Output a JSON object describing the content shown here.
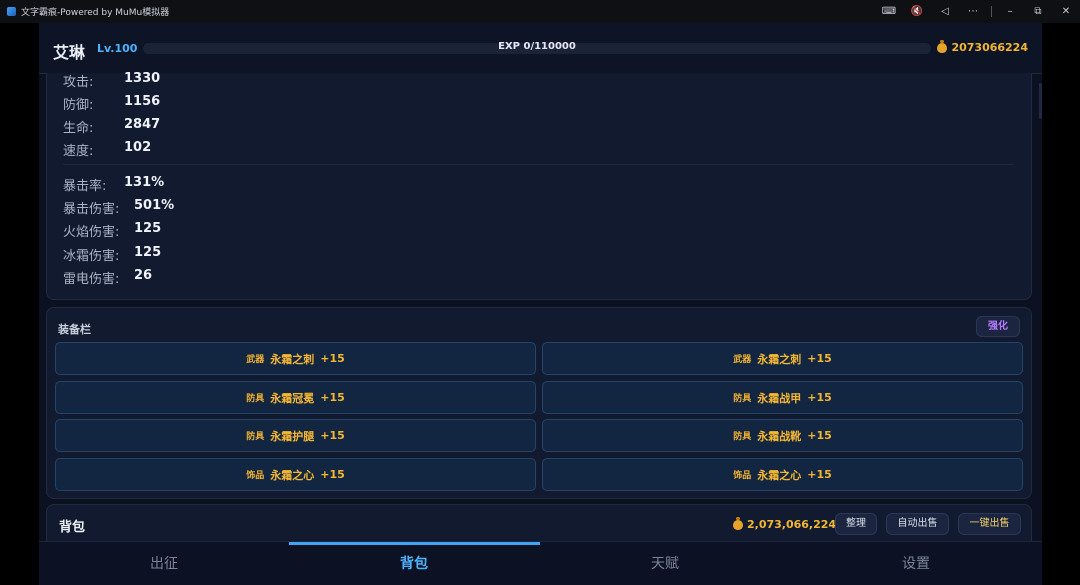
{
  "window": {
    "title": "文字霸痕-Powered by MuMu模拟器",
    "controls": [
      "⌨",
      "🔇",
      "◁",
      "⋯",
      "–",
      "⧉",
      "✕"
    ]
  },
  "header": {
    "name": "艾琳",
    "level": "Lv.100",
    "exp": "EXP 0/110000",
    "exp_progress": 0,
    "gold": "2073066224"
  },
  "stats": {
    "basic": [
      {
        "label": "攻击:",
        "value": "1330"
      },
      {
        "label": "防御:",
        "value": "1156"
      },
      {
        "label": "生命:",
        "value": "2847"
      },
      {
        "label": "速度:",
        "value": "102"
      }
    ],
    "advanced": [
      {
        "label": "暴击率:",
        "value": "131%"
      },
      {
        "label": "暴击伤害:",
        "value": "501%"
      },
      {
        "label": "火焰伤害:",
        "value": "125"
      },
      {
        "label": "冰霜伤害:",
        "value": "125"
      },
      {
        "label": "雷电伤害:",
        "value": "26"
      }
    ]
  },
  "equipment": {
    "title": "装备栏",
    "enhance_label": "强化",
    "slots": [
      {
        "category": "武器",
        "name": "永霜之刺",
        "plus": "+15"
      },
      {
        "category": "武器",
        "name": "永霜之刺",
        "plus": "+15"
      },
      {
        "category": "防具",
        "name": "永霜冠冕",
        "plus": "+15"
      },
      {
        "category": "防具",
        "name": "永霜战甲",
        "plus": "+15"
      },
      {
        "category": "防具",
        "name": "永霜护腿",
        "plus": "+15"
      },
      {
        "category": "防具",
        "name": "永霜战靴",
        "plus": "+15"
      },
      {
        "category": "饰品",
        "name": "永霜之心",
        "plus": "+15"
      },
      {
        "category": "饰品",
        "name": "永霜之心",
        "plus": "+15"
      }
    ]
  },
  "backpack": {
    "title": "背包",
    "gold": "2,073,066,224",
    "sort_label": "整理",
    "auto_sell_label": "自动出售",
    "sell_all_label": "一键出售"
  },
  "nav": {
    "tabs": [
      {
        "label": "出征",
        "active": false
      },
      {
        "label": "背包",
        "active": true
      },
      {
        "label": "天赋",
        "active": false
      },
      {
        "label": "设置",
        "active": false
      }
    ]
  },
  "colors": {
    "accent_blue": "#4db3ff",
    "gold": "#f5b731",
    "enhance_purple": "#b57bff",
    "panel_bg": "#111a2e"
  }
}
